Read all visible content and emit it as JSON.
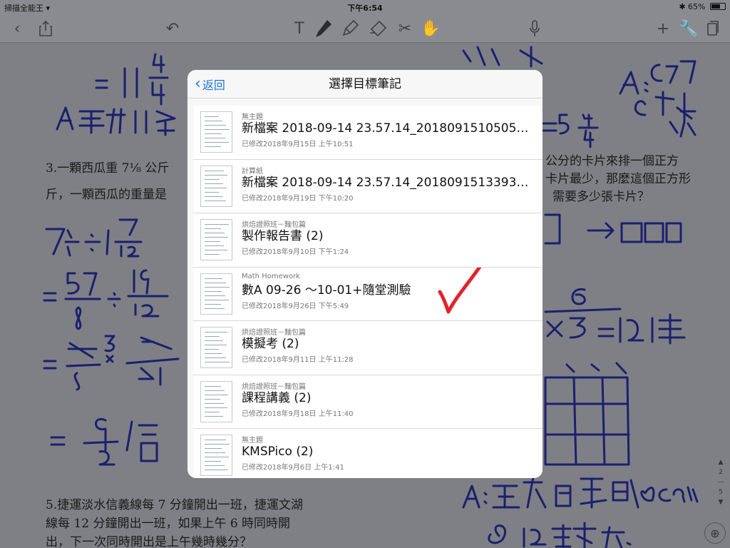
{
  "status": {
    "app": "掃描全能王",
    "time": "下午6:54",
    "battery": "65%",
    "battery_level": 0.65
  },
  "toolbar": {
    "items": [
      "back-icon",
      "share-icon",
      "undo-icon",
      "text-icon",
      "pen-icon",
      "highlighter-icon",
      "eraser-icon",
      "scissors-icon",
      "hand-icon",
      "microphone-icon",
      "add-icon",
      "wrench-icon",
      "pages-icon"
    ]
  },
  "worksheet": {
    "q3_line1": "3.一顆西瓜重 7⅛ 公斤",
    "q3_line2": "斤，一顆西瓜的重量是",
    "q4_line1": "公分的卡片來排一個正方",
    "q4_line2": "卡片最少，那麼這個正方形",
    "q4_line3": "需要多少張卡片？",
    "q5_line1": "5.捷運淡水信義線每 7 分鐘開出一班，捷運文湖",
    "q5_line2": "線每 12 分鐘開出一班，如果上午 6 時同時開",
    "q5_line3": "出，下一次同時開出是上午幾時幾分？",
    "page_current": "2",
    "page_total": "5"
  },
  "modal": {
    "back_label": "返回",
    "title": "選擇目標筆記",
    "notes": [
      {
        "notebook": "無主題",
        "name": "新檔案 2018-09-14 23.57.14_20180915105051...",
        "date": "已修改2018年9月15日 上午10:51"
      },
      {
        "notebook": "計算紙",
        "name": "新檔案 2018-09-14 23.57.14_20180915133934...",
        "date": "已修改2018年9月19日 下午10:20"
      },
      {
        "notebook": "烘焙證照班－麵包篇",
        "name": "製作報告書 (2)",
        "date": "已修改2018年9月10日 下午1:24"
      },
      {
        "notebook": "Math Homework",
        "name": "數A 09-26 ～10-01+隨堂測驗",
        "date": "已修改2018年9月26日 下午5:49"
      },
      {
        "notebook": "烘焙證照班－麵包篇",
        "name": "模擬考 (2)",
        "date": "已修改2018年9月11日 上午11:28"
      },
      {
        "notebook": "烘焙證照班－麵包篇",
        "name": "課程講義 (2)",
        "date": "已修改2018年9月18日 上午11:40"
      },
      {
        "notebook": "無主題",
        "name": "KMSPico (2)",
        "date": "已修改2018年9月6日 上午1:41"
      }
    ]
  },
  "colors": {
    "ink": "#1c1f6e",
    "check": "#e0242a",
    "link": "#1f72d8"
  }
}
